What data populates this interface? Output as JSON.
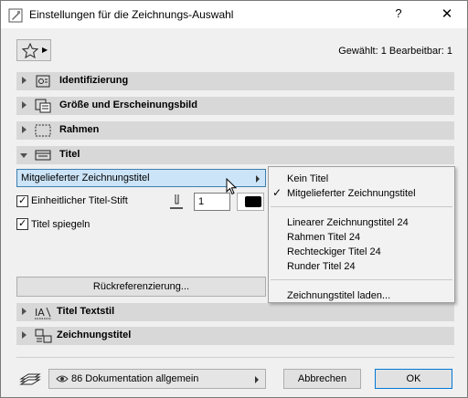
{
  "window": {
    "title": "Einstellungen für die Zeichnungs-Auswahl",
    "help": "?",
    "close": "✕"
  },
  "header": {
    "selection_info": "Gewählt: 1 Bearbeitbar: 1"
  },
  "sections": {
    "identifizierung": "Identifizierung",
    "groesse": "Größe und Erscheinungsbild",
    "rahmen": "Rahmen",
    "titel": "Titel",
    "textstil": "Titel Textstil",
    "zeichnungstitel": "Zeichnungstitel"
  },
  "titel_panel": {
    "preset_value": "Mitgelieferter Zeichnungstitel",
    "pen_checkbox_label": "Einheitlicher Titel-Stift",
    "pen_checkbox_checked": true,
    "pen_value": "1",
    "pen_color": "#000000",
    "mirror_checkbox_label": "Titel spiegeln",
    "mirror_checkbox_checked": true,
    "crossref_button": "Rückreferenzierung..."
  },
  "menu": {
    "items": [
      {
        "label": "Kein Titel",
        "checked": false
      },
      {
        "label": "Mitgelieferter Zeichnungstitel",
        "checked": true
      },
      {
        "label": "Linearer Zeichnungstitel 24",
        "checked": false
      },
      {
        "label": "Rahmen Titel 24",
        "checked": false
      },
      {
        "label": "Rechteckiger Titel 24",
        "checked": false
      },
      {
        "label": "Runder Titel 24",
        "checked": false
      },
      {
        "label": "Zeichnungstitel laden...",
        "checked": false
      }
    ],
    "check_glyph": "✓"
  },
  "footer": {
    "layer_value": "86 Dokumentation allgemein",
    "cancel_button": "Abbrechen",
    "ok_button": "OK"
  },
  "colors": {
    "section_bg": "#d8d8d8",
    "highlight": "#cce4f7",
    "accent": "#0078d7"
  }
}
